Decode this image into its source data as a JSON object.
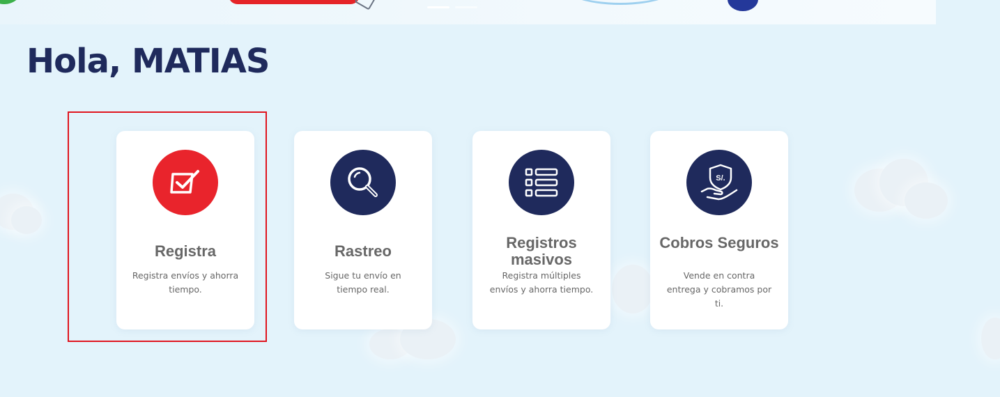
{
  "greeting": "Hola, MATIAS",
  "cards": [
    {
      "title": "Registra",
      "description": "Registra envíos y ahorra tiempo.",
      "icon": "checkbox-icon",
      "icon_color": "#e9242c"
    },
    {
      "title": "Rastreo",
      "description": "Sigue tu envío en tiempo real.",
      "icon": "magnifier-icon",
      "icon_color": "#1f2a5c"
    },
    {
      "title": "Registros masivos",
      "description": "Registra múltiples envíos y ahorra tiempo.",
      "icon": "list-icon",
      "icon_color": "#1f2a5c"
    },
    {
      "title": "Cobros Seguros",
      "description": "Vende en contra entrega y cobramos por ti.",
      "icon": "shield-hand-icon",
      "icon_color": "#1f2a5c",
      "icon_text": "S/."
    }
  ],
  "colors": {
    "page_bg": "#e3f3fb",
    "brand_navy": "#1f2a5c",
    "brand_red": "#e9242c",
    "highlight_border": "#e0141e",
    "card_text": "#676767"
  },
  "banner": {
    "carousel_slides": 2,
    "active_slide": 1
  }
}
